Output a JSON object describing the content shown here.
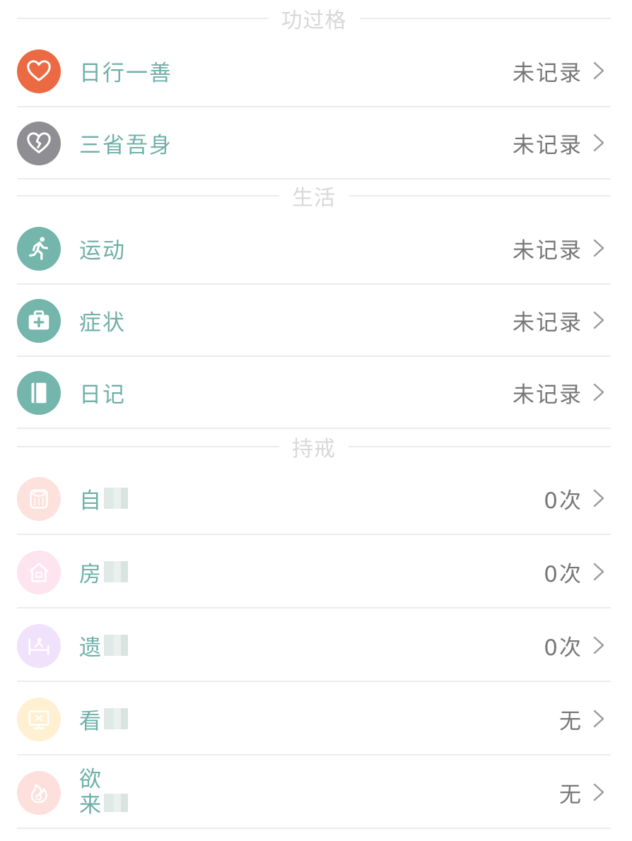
{
  "sections": {
    "merits": {
      "title": "功过格"
    },
    "life": {
      "title": "生活"
    },
    "abstinence": {
      "title": "持戒"
    }
  },
  "rows": {
    "good_deed": {
      "label": "日行一善",
      "value": "未记录",
      "icon": "heart-icon",
      "icon_color": "#ec6a43"
    },
    "reflection": {
      "label": "三省吾身",
      "value": "未记录",
      "icon": "broken-heart-icon",
      "icon_color": "#8f8f93"
    },
    "exercise": {
      "label": "运动",
      "value": "未记录",
      "icon": "running-icon",
      "icon_color": "#74b5ac"
    },
    "symptoms": {
      "label": "症状",
      "value": "未记录",
      "icon": "medical-kit-icon",
      "icon_color": "#74b5ac"
    },
    "diary": {
      "label": "日记",
      "value": "未记录",
      "icon": "notebook-icon",
      "icon_color": "#74b5ac"
    },
    "self": {
      "label": "自",
      "value": "0次",
      "icon": "tissue-roll-icon",
      "icon_color": "#fde1dc"
    },
    "house": {
      "label": "房",
      "value": "0次",
      "icon": "house-icon",
      "icon_color": "#fde4ee"
    },
    "emission": {
      "label": "遗",
      "value": "0次",
      "icon": "bed-icon",
      "icon_color": "#f0e2fb"
    },
    "watch": {
      "label": "看",
      "value": "无",
      "icon": "monitor-icon",
      "icon_color": "#fff0d2"
    },
    "desire": {
      "label_line1": "欲",
      "label_line2": "来",
      "value": "无",
      "icon": "flame-icon",
      "icon_color": "#fde0dc"
    }
  }
}
